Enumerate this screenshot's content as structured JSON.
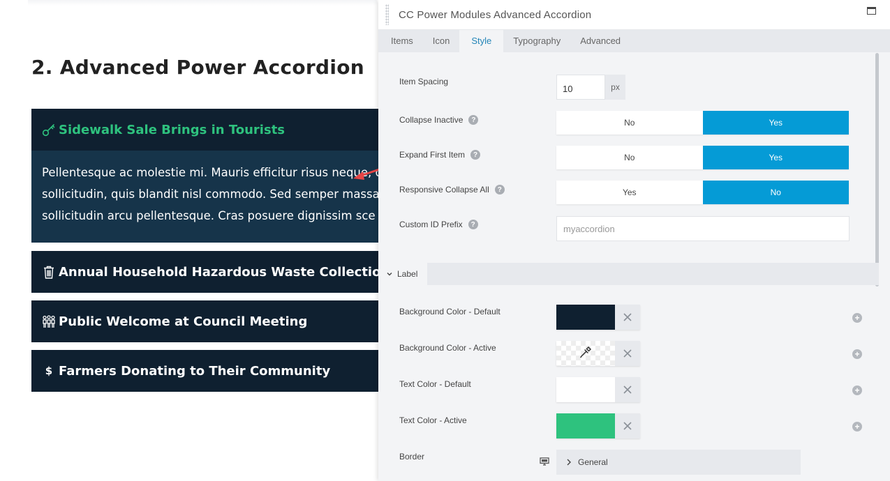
{
  "page": {
    "heading": "2. Advanced Power Accordion",
    "accordion": [
      {
        "title": "Sidewalk Sale Brings in Tourists",
        "icon": "key-icon",
        "active": true
      },
      {
        "title": "Annual Household Hazardous Waste Collection",
        "icon": "trash-icon"
      },
      {
        "title": "Public Welcome at Council Meeting",
        "icon": "people-icon"
      },
      {
        "title": "Farmers Donating to Their Community",
        "icon": "dollar-icon",
        "icon_glyph": "$"
      }
    ],
    "body_lines": [
      "Pellentesque ac molestie mi. Mauris efficitur risus neque, c",
      "sollicitudin, quis blandit nisl commodo. Sed semper massa",
      "sollicitudin arcu pellentesque. Cras posuere dignissim sce"
    ]
  },
  "panel": {
    "title": "CC Power Modules Advanced Accordion",
    "tabs": [
      "Items",
      "Icon",
      "Style",
      "Typography",
      "Advanced"
    ],
    "active_tab": "Style",
    "fields": {
      "item_spacing": {
        "label": "Item Spacing",
        "value": "10",
        "unit": "px"
      },
      "collapse_inactive": {
        "label": "Collapse Inactive",
        "left": "No",
        "right": "Yes"
      },
      "expand_first": {
        "label": "Expand First Item",
        "left": "No",
        "right": "Yes"
      },
      "responsive_collapse": {
        "label": "Responsive Collapse All",
        "left": "Yes",
        "right": "No"
      },
      "custom_id": {
        "label": "Custom ID Prefix",
        "placeholder": "myaccordion"
      }
    },
    "label_section": {
      "title": "Label",
      "bg_default": {
        "label": "Background Color - Default",
        "color": "#0f2030"
      },
      "bg_active": {
        "label": "Background Color - Active"
      },
      "text_default": {
        "label": "Text Color - Default",
        "color": "#ffffff"
      },
      "text_active": {
        "label": "Text Color - Active",
        "color": "#2ec27e"
      },
      "border": {
        "label": "Border",
        "option": "General"
      }
    }
  },
  "colors": {
    "accent": "#059bd6",
    "active_tab": "#2586b8",
    "accordion_bg": "#0f2030",
    "accordion_body": "#16344a",
    "green": "#2ec27e",
    "arrow": "#e64545"
  },
  "icons": {
    "help": "question-circle-icon",
    "clear": "x-icon",
    "add": "plus-circle-icon",
    "eyedropper": "eyedropper-icon",
    "monitor": "monitor-icon"
  }
}
